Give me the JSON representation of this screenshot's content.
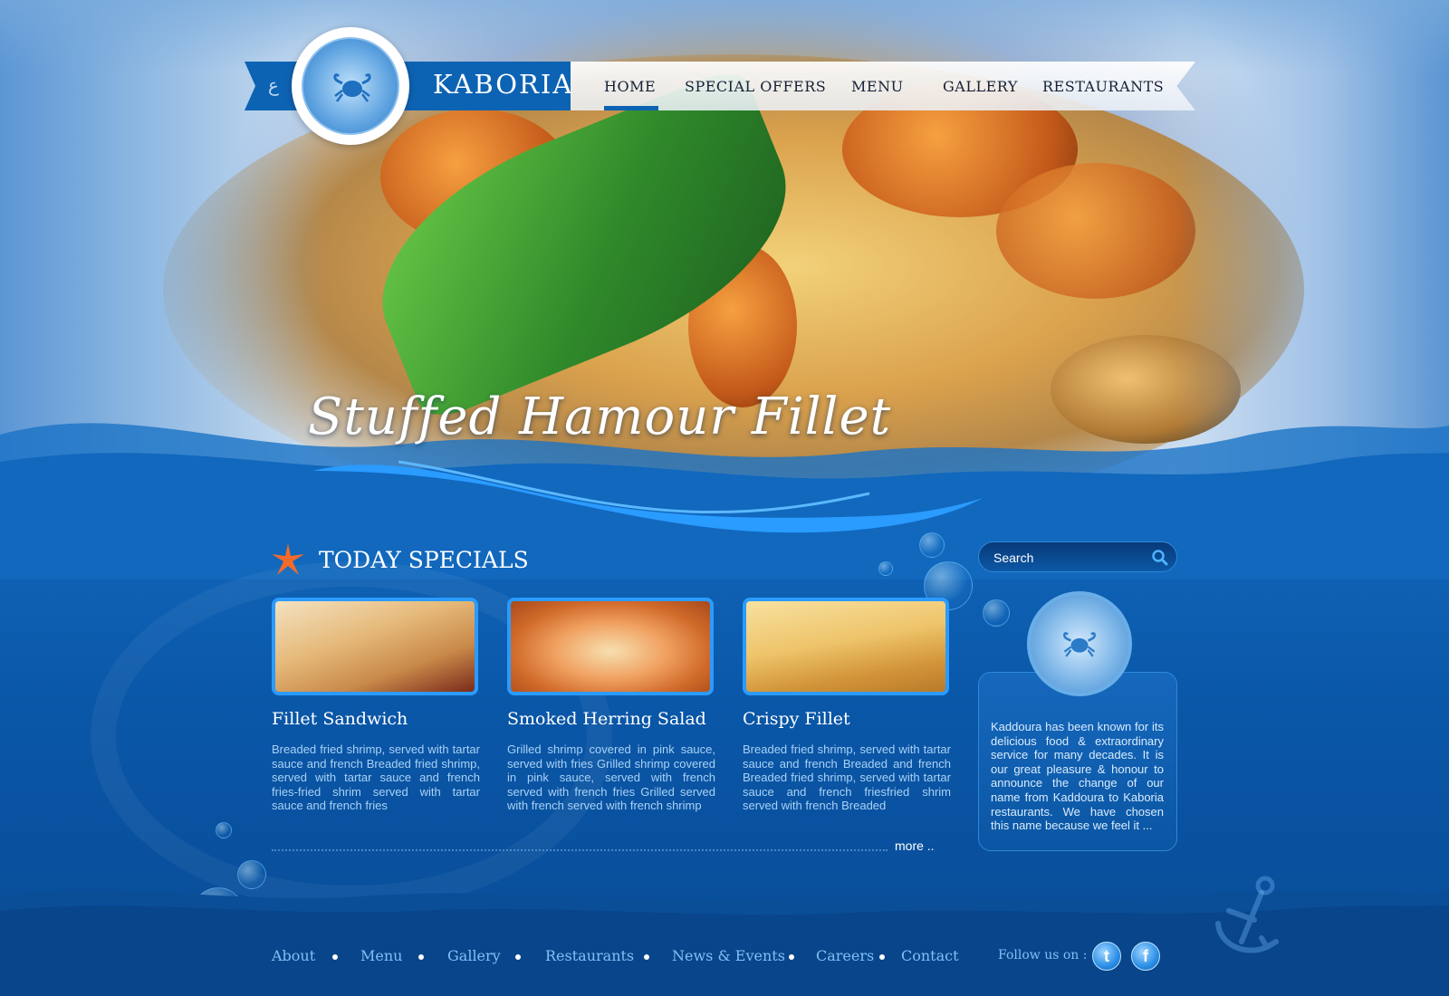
{
  "brand": {
    "name": "KABORIA",
    "arabic_toggle": "ع"
  },
  "nav": {
    "items": [
      {
        "label": "HOME",
        "active": true
      },
      {
        "label": "SPECIAL OFFERS",
        "active": false
      },
      {
        "label": "MENU",
        "active": false
      },
      {
        "label": "GALLERY",
        "active": false
      },
      {
        "label": "RESTAURANTS",
        "active": false
      }
    ]
  },
  "hero": {
    "title": "Stuffed Hamour Fillet"
  },
  "specials": {
    "title": "TODAY SPECIALS",
    "more_label": "more ..",
    "cards": [
      {
        "title": "Fillet Sandwich",
        "description": "Breaded fried shrimp, served with tartar sauce and french Breaded fried shrimp, served with tartar sauce and french fries-fried shrim served with tartar sauce and french fries"
      },
      {
        "title": "Smoked Herring Salad",
        "description": "Grilled shrimp covered in pink sauce, served with fries Grilled shrimp covered in pink sauce, served with french served with french fries Grilled served with french served with french  shrimp"
      },
      {
        "title": "Crispy Fillet",
        "description": "Breaded fried shrimp, served with tartar sauce and french Breaded and french Breaded fried shrimp, served with tartar sauce and french friesfried shrim served with french Breaded"
      }
    ]
  },
  "sidebar": {
    "search_placeholder": "Search",
    "about_text": "Kaddoura has been known for its delicious food & extraordinary service for many decades. It is our great pleasure & honour to announce the change of our name from Kaddoura to Kaboria restaurants. We have chosen this name because we feel it ..."
  },
  "footer": {
    "links": [
      "About",
      "Menu",
      "Gallery",
      "Restaurants",
      "News & Events",
      "Careers",
      "Contact"
    ],
    "follow_label": "Follow us on :",
    "social": [
      {
        "icon": "twitter-icon",
        "glyph": "t"
      },
      {
        "icon": "facebook-icon",
        "glyph": "f"
      }
    ]
  },
  "colors": {
    "primary_blue": "#0d63b3",
    "accent_orange": "#f26b2b",
    "text_light_blue": "#a9d2f6"
  }
}
